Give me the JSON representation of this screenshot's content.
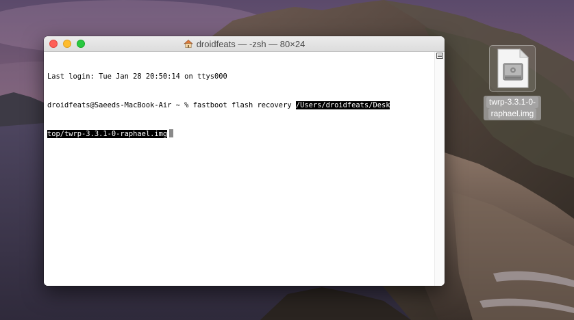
{
  "window": {
    "title": "droidfeats — -zsh — 80×24",
    "title_icon": "home-icon"
  },
  "terminal": {
    "line1": "Last login: Tue Jan 28 20:50:14 on ttys000",
    "line2_prompt": "droidfeats@Saeeds-MacBook-Air ~ % fastboot flash recovery ",
    "line2_selected": "/Users/droidfeats/Desk",
    "line3_selected": "top/twrp-3.3.1-0-raphael.img",
    "line3_after": " "
  },
  "desktop": {
    "file_label_line1": "twrp-3.3.1-0-",
    "file_label_line2": "raphael.img",
    "file_icon": "disk-image-icon"
  },
  "colors": {
    "close": "#fe5f57",
    "minimize": "#febc2e",
    "maximize": "#28c840",
    "selection_bg": "#000000",
    "selection_fg": "#ffffff"
  }
}
